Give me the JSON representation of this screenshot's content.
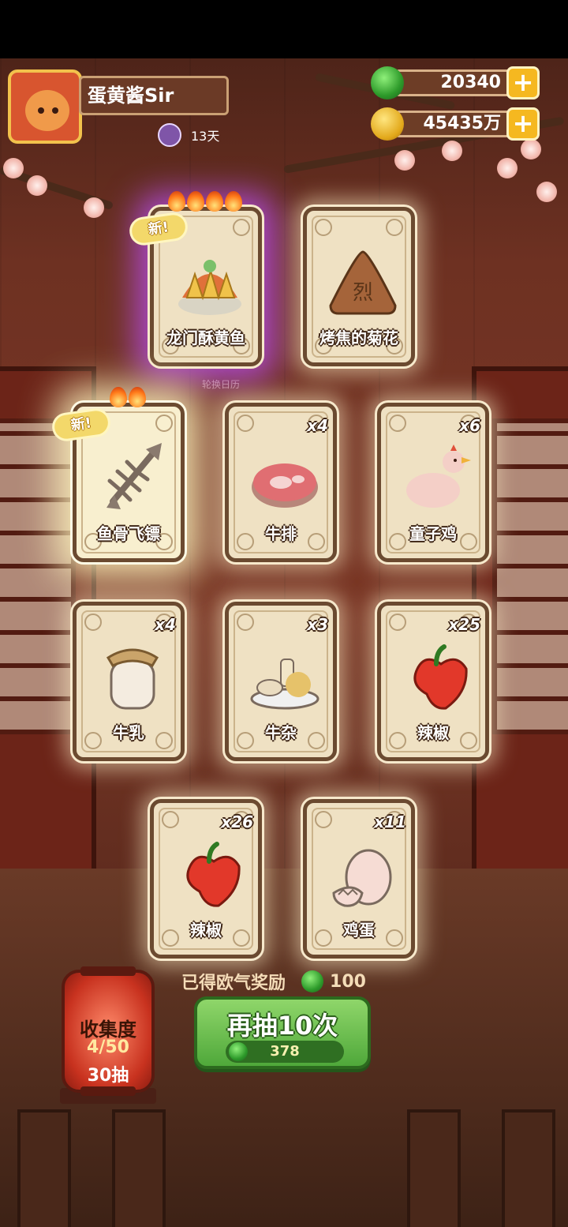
{
  "player": {
    "name": "蛋黄酱Sir",
    "days": "13天"
  },
  "resources": {
    "jade": "20340",
    "coins": "45435万",
    "plus_label": "+"
  },
  "rotate_calendar_label": "轮换日历",
  "cards": [
    {
      "name": "龙门酥黄鱼",
      "count": "",
      "new": true,
      "flames": 4,
      "glow": "purple",
      "icon": "fried-yellow-fish-dish-icon"
    },
    {
      "name": "烤焦的菊花",
      "count": "",
      "new": false,
      "flames": 0,
      "glow": "white",
      "icon": "burnt-chrysanthemum-icon"
    },
    {
      "name": "鱼骨飞镖",
      "count": "",
      "new": true,
      "flames": 2,
      "glow": "yellow",
      "icon": "fishbone-dart-icon"
    },
    {
      "name": "牛排",
      "count": "x4",
      "new": false,
      "flames": 0,
      "glow": "white",
      "icon": "steak-icon"
    },
    {
      "name": "童子鸡",
      "count": "x6",
      "new": false,
      "flames": 0,
      "glow": "white",
      "icon": "young-chicken-icon"
    },
    {
      "name": "牛乳",
      "count": "x4",
      "new": false,
      "flames": 0,
      "glow": "white",
      "icon": "milk-jar-icon"
    },
    {
      "name": "牛杂",
      "count": "x3",
      "new": false,
      "flames": 0,
      "glow": "white",
      "icon": "beef-offal-icon"
    },
    {
      "name": "辣椒",
      "count": "x25",
      "new": false,
      "flames": 0,
      "glow": "white",
      "icon": "chili-pepper-icon"
    },
    {
      "name": "辣椒",
      "count": "x26",
      "new": false,
      "flames": 0,
      "glow": "white",
      "icon": "chili-pepper-icon"
    },
    {
      "name": "鸡蛋",
      "count": "x11",
      "new": false,
      "flames": 0,
      "glow": "white",
      "icon": "egg-icon"
    }
  ],
  "new_tag": "新",
  "luck_reward": {
    "label": "已得欧气奖励",
    "value": "100"
  },
  "collection": {
    "title": "收集度",
    "progress": "4/50",
    "pulls": "30抽"
  },
  "draw_button": {
    "label": "再抽10次",
    "cost": "378"
  },
  "colors": {
    "jade_green": "#2d9a2a",
    "coin_gold": "#e2a81a",
    "button_green": "#6ec04f",
    "card_parchment": "#efe1c3",
    "card_border": "#6b4a30",
    "wall_red": "#6e3122"
  }
}
